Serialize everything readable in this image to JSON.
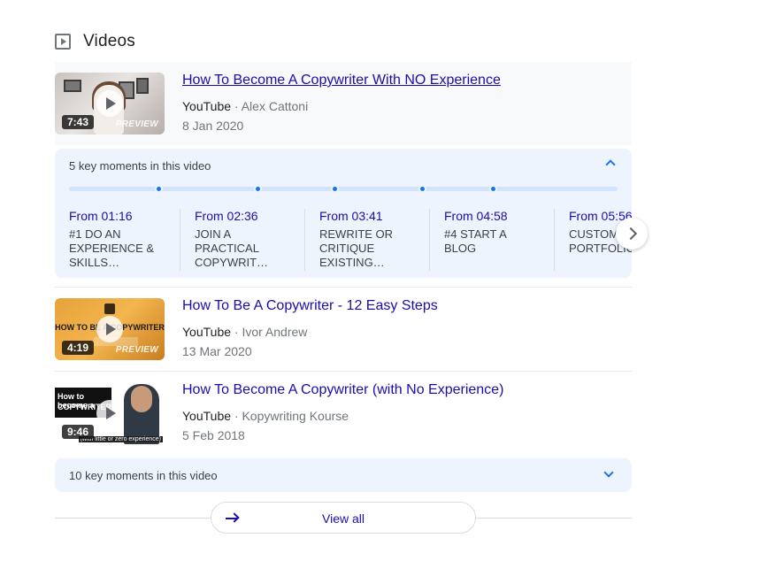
{
  "section": {
    "title": "Videos",
    "icon": "play-square-icon"
  },
  "videos": [
    {
      "title": "How To Become A Copywriter With NO Experience",
      "source": "YouTube",
      "separator": "·",
      "author": "Alex Cattoni",
      "date": "8 Jan 2020",
      "duration": "7:43",
      "preview": "PREVIEW"
    },
    {
      "title": "How To Be A Copywriter - 12 Easy Steps",
      "source": "YouTube",
      "separator": "·",
      "author": "Ivor Andrew",
      "date": "13 Mar 2020",
      "duration": "4:19",
      "preview": "PREVIEW",
      "thumb_text": "HOW TO BE A COPYWRITER"
    },
    {
      "title": "How To Become A Copywriter (with No Experience)",
      "source": "YouTube",
      "separator": "·",
      "author": "Kopywriting Kourse",
      "date": "5 Feb 2018",
      "duration": "9:46",
      "thumb_line1": "How to become a",
      "thumb_line2": "COPYWRITER",
      "thumb_caption": "(with little or zero experience)"
    }
  ],
  "key_moments": {
    "header": "5 key moments in this video",
    "items": [
      {
        "from": "From 01:16",
        "label": "#1 DO AN EXPERIENCE & SKILLS…"
      },
      {
        "from": "From 02:36",
        "label": "JOIN A PRACTICAL COPYWRIT…"
      },
      {
        "from": "From 03:41",
        "label": "REWRITE OR CRITIQUE EXISTING…"
      },
      {
        "from": "From 04:58",
        "label": "#4 START A BLOG"
      },
      {
        "from": "From 05:56",
        "label": "CUSTOM YOUR PORTFOLIO"
      }
    ]
  },
  "key_moments_collapsed": {
    "header": "10 key moments in this video"
  },
  "view_all": {
    "label": "View all"
  },
  "colors": {
    "link": "#1a0dab",
    "accent": "#1a73e8",
    "panel": "#eef4fe"
  }
}
